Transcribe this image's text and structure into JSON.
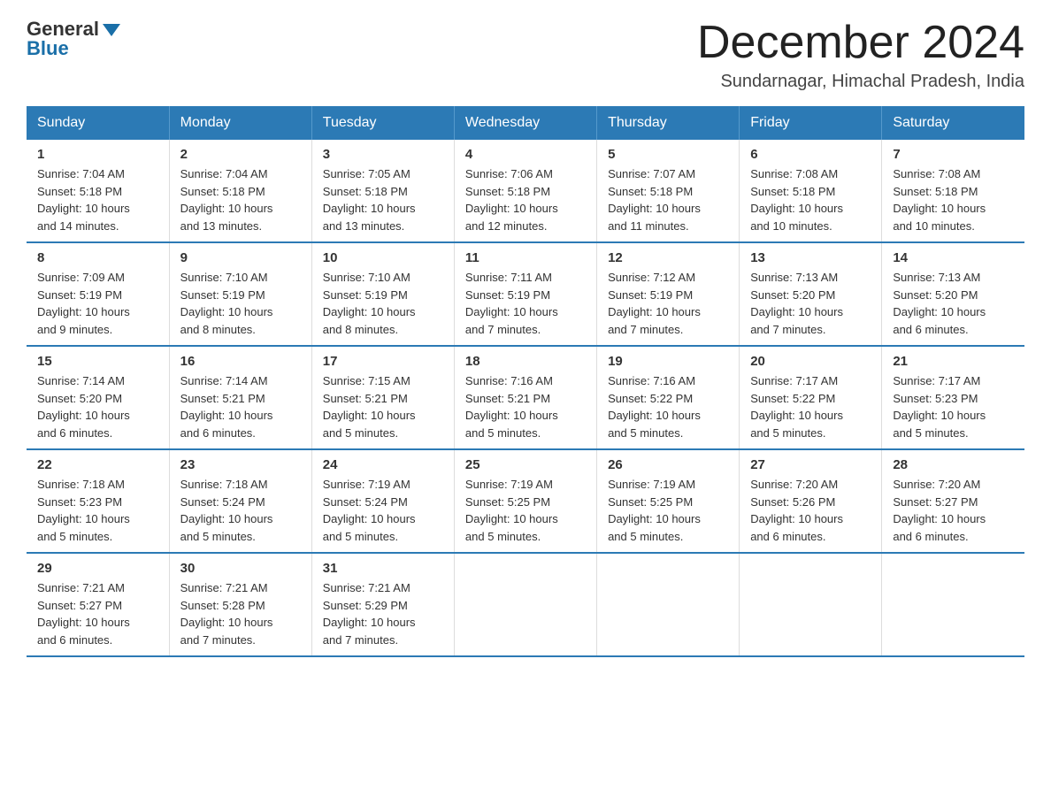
{
  "header": {
    "logo_general": "General",
    "logo_blue": "Blue",
    "title": "December 2024",
    "location": "Sundarnagar, Himachal Pradesh, India"
  },
  "weekdays": [
    "Sunday",
    "Monday",
    "Tuesday",
    "Wednesday",
    "Thursday",
    "Friday",
    "Saturday"
  ],
  "weeks": [
    [
      {
        "day": "1",
        "sunrise": "7:04 AM",
        "sunset": "5:18 PM",
        "daylight": "10 hours and 14 minutes."
      },
      {
        "day": "2",
        "sunrise": "7:04 AM",
        "sunset": "5:18 PM",
        "daylight": "10 hours and 13 minutes."
      },
      {
        "day": "3",
        "sunrise": "7:05 AM",
        "sunset": "5:18 PM",
        "daylight": "10 hours and 13 minutes."
      },
      {
        "day": "4",
        "sunrise": "7:06 AM",
        "sunset": "5:18 PM",
        "daylight": "10 hours and 12 minutes."
      },
      {
        "day": "5",
        "sunrise": "7:07 AM",
        "sunset": "5:18 PM",
        "daylight": "10 hours and 11 minutes."
      },
      {
        "day": "6",
        "sunrise": "7:08 AM",
        "sunset": "5:18 PM",
        "daylight": "10 hours and 10 minutes."
      },
      {
        "day": "7",
        "sunrise": "7:08 AM",
        "sunset": "5:18 PM",
        "daylight": "10 hours and 10 minutes."
      }
    ],
    [
      {
        "day": "8",
        "sunrise": "7:09 AM",
        "sunset": "5:19 PM",
        "daylight": "10 hours and 9 minutes."
      },
      {
        "day": "9",
        "sunrise": "7:10 AM",
        "sunset": "5:19 PM",
        "daylight": "10 hours and 8 minutes."
      },
      {
        "day": "10",
        "sunrise": "7:10 AM",
        "sunset": "5:19 PM",
        "daylight": "10 hours and 8 minutes."
      },
      {
        "day": "11",
        "sunrise": "7:11 AM",
        "sunset": "5:19 PM",
        "daylight": "10 hours and 7 minutes."
      },
      {
        "day": "12",
        "sunrise": "7:12 AM",
        "sunset": "5:19 PM",
        "daylight": "10 hours and 7 minutes."
      },
      {
        "day": "13",
        "sunrise": "7:13 AM",
        "sunset": "5:20 PM",
        "daylight": "10 hours and 7 minutes."
      },
      {
        "day": "14",
        "sunrise": "7:13 AM",
        "sunset": "5:20 PM",
        "daylight": "10 hours and 6 minutes."
      }
    ],
    [
      {
        "day": "15",
        "sunrise": "7:14 AM",
        "sunset": "5:20 PM",
        "daylight": "10 hours and 6 minutes."
      },
      {
        "day": "16",
        "sunrise": "7:14 AM",
        "sunset": "5:21 PM",
        "daylight": "10 hours and 6 minutes."
      },
      {
        "day": "17",
        "sunrise": "7:15 AM",
        "sunset": "5:21 PM",
        "daylight": "10 hours and 5 minutes."
      },
      {
        "day": "18",
        "sunrise": "7:16 AM",
        "sunset": "5:21 PM",
        "daylight": "10 hours and 5 minutes."
      },
      {
        "day": "19",
        "sunrise": "7:16 AM",
        "sunset": "5:22 PM",
        "daylight": "10 hours and 5 minutes."
      },
      {
        "day": "20",
        "sunrise": "7:17 AM",
        "sunset": "5:22 PM",
        "daylight": "10 hours and 5 minutes."
      },
      {
        "day": "21",
        "sunrise": "7:17 AM",
        "sunset": "5:23 PM",
        "daylight": "10 hours and 5 minutes."
      }
    ],
    [
      {
        "day": "22",
        "sunrise": "7:18 AM",
        "sunset": "5:23 PM",
        "daylight": "10 hours and 5 minutes."
      },
      {
        "day": "23",
        "sunrise": "7:18 AM",
        "sunset": "5:24 PM",
        "daylight": "10 hours and 5 minutes."
      },
      {
        "day": "24",
        "sunrise": "7:19 AM",
        "sunset": "5:24 PM",
        "daylight": "10 hours and 5 minutes."
      },
      {
        "day": "25",
        "sunrise": "7:19 AM",
        "sunset": "5:25 PM",
        "daylight": "10 hours and 5 minutes."
      },
      {
        "day": "26",
        "sunrise": "7:19 AM",
        "sunset": "5:25 PM",
        "daylight": "10 hours and 5 minutes."
      },
      {
        "day": "27",
        "sunrise": "7:20 AM",
        "sunset": "5:26 PM",
        "daylight": "10 hours and 6 minutes."
      },
      {
        "day": "28",
        "sunrise": "7:20 AM",
        "sunset": "5:27 PM",
        "daylight": "10 hours and 6 minutes."
      }
    ],
    [
      {
        "day": "29",
        "sunrise": "7:21 AM",
        "sunset": "5:27 PM",
        "daylight": "10 hours and 6 minutes."
      },
      {
        "day": "30",
        "sunrise": "7:21 AM",
        "sunset": "5:28 PM",
        "daylight": "10 hours and 7 minutes."
      },
      {
        "day": "31",
        "sunrise": "7:21 AM",
        "sunset": "5:29 PM",
        "daylight": "10 hours and 7 minutes."
      },
      null,
      null,
      null,
      null
    ]
  ],
  "labels": {
    "sunrise": "Sunrise: ",
    "sunset": "Sunset: ",
    "daylight": "Daylight: "
  }
}
